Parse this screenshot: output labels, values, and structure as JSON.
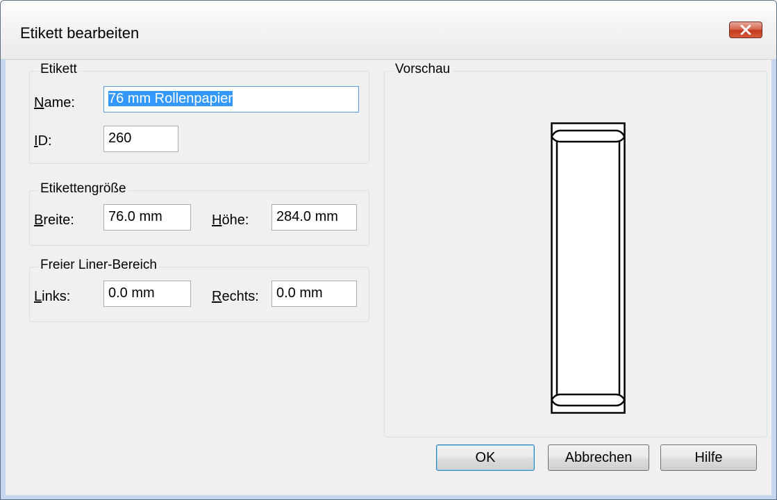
{
  "window": {
    "title": "Etikett bearbeiten"
  },
  "etikett": {
    "legend": "Etikett",
    "name_label_u": "N",
    "name_label_rest": "ame:",
    "name_value": "76 mm Rollenpapier",
    "id_label_u": "I",
    "id_label_rest": "D:",
    "id_value": "260"
  },
  "size": {
    "legend": "Etikettengröße",
    "width_label_u": "B",
    "width_label_rest": "reite:",
    "width_value": "76.0 mm",
    "height_label_u": "H",
    "height_label_rest": "öhe:",
    "height_value": "284.0 mm"
  },
  "liner": {
    "legend": "Freier Liner-Bereich",
    "left_label_u": "L",
    "left_label_rest": "inks:",
    "left_value": "0.0 mm",
    "right_label_u": "R",
    "right_label_rest": "echts:",
    "right_value": "0.0 mm"
  },
  "preview": {
    "legend": "Vorschau"
  },
  "buttons": {
    "ok": "OK",
    "cancel": "Abbrechen",
    "help": "Hilfe"
  },
  "icons": {
    "close": "close-icon",
    "label_roll": "label-roll-icon"
  }
}
